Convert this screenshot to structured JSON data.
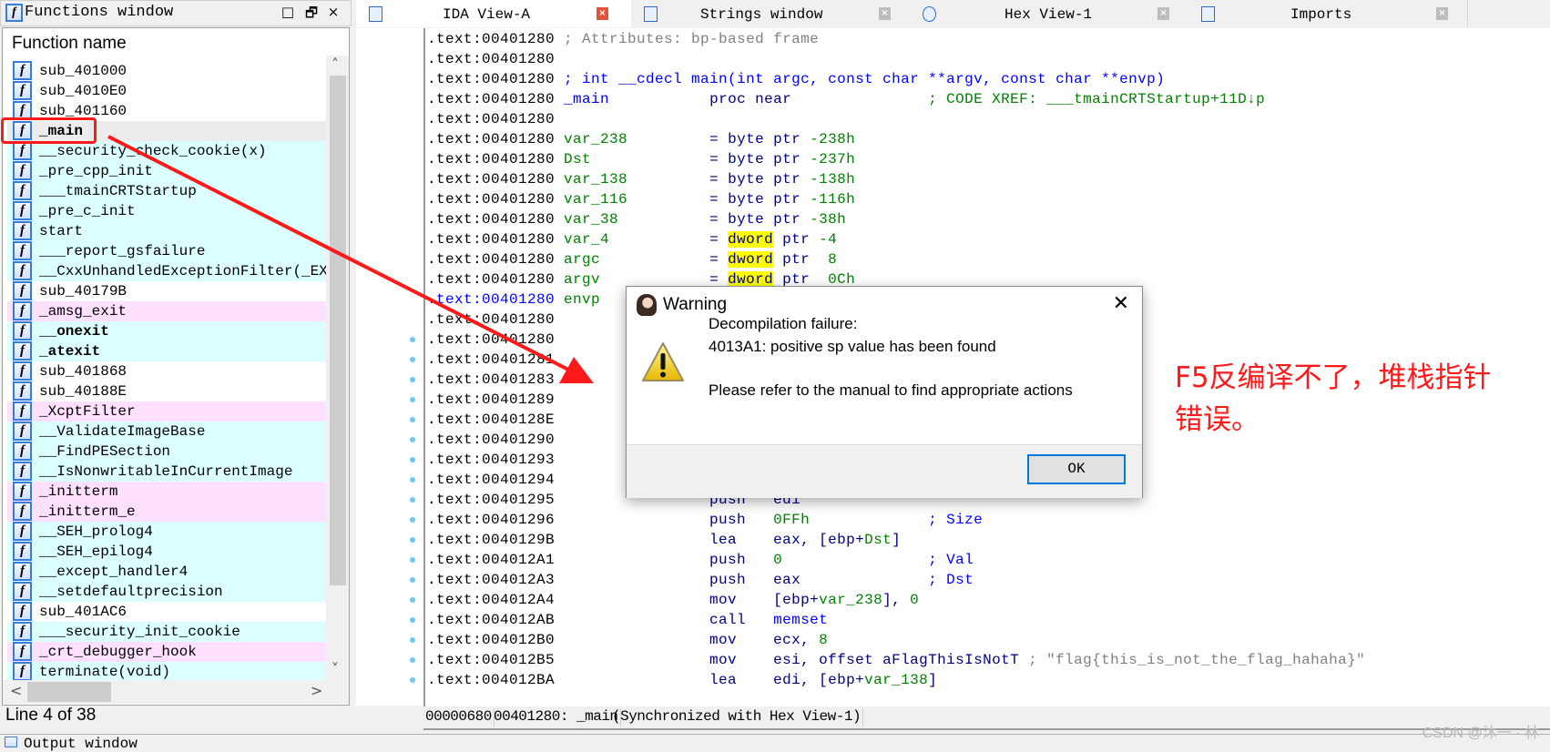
{
  "functions_window": {
    "title": "Functions window",
    "buttons": {
      "maximize": "□",
      "float": "🗗",
      "close": "×"
    },
    "column_header": "Function name",
    "items": [
      {
        "name": "sub_401000",
        "bg": "w"
      },
      {
        "name": "sub_4010E0",
        "bg": "w"
      },
      {
        "name": "sub_401160",
        "bg": "w"
      },
      {
        "name": "_main",
        "bg": "s",
        "bold": true,
        "selected": true
      },
      {
        "name": "__security_check_cookie(x)",
        "bg": "c"
      },
      {
        "name": "_pre_cpp_init",
        "bg": "c"
      },
      {
        "name": "___tmainCRTStartup",
        "bg": "c"
      },
      {
        "name": "_pre_c_init",
        "bg": "c"
      },
      {
        "name": "start",
        "bg": "c"
      },
      {
        "name": "___report_gsfailure",
        "bg": "c"
      },
      {
        "name": "__CxxUnhandledExceptionFilter(_EXCE",
        "bg": "c"
      },
      {
        "name": "sub_40179B",
        "bg": "w"
      },
      {
        "name": "_amsg_exit",
        "bg": "p"
      },
      {
        "name": "__onexit",
        "bg": "c",
        "bold": true
      },
      {
        "name": "_atexit",
        "bg": "c",
        "bold": true
      },
      {
        "name": "sub_401868",
        "bg": "w"
      },
      {
        "name": "sub_40188E",
        "bg": "w"
      },
      {
        "name": "_XcptFilter",
        "bg": "p"
      },
      {
        "name": "__ValidateImageBase",
        "bg": "c"
      },
      {
        "name": "__FindPESection",
        "bg": "c"
      },
      {
        "name": "__IsNonwritableInCurrentImage",
        "bg": "c"
      },
      {
        "name": "_initterm",
        "bg": "p"
      },
      {
        "name": "_initterm_e",
        "bg": "p"
      },
      {
        "name": "__SEH_prolog4",
        "bg": "c"
      },
      {
        "name": "__SEH_epilog4",
        "bg": "c"
      },
      {
        "name": "__except_handler4",
        "bg": "c"
      },
      {
        "name": "__setdefaultprecision",
        "bg": "c"
      },
      {
        "name": "sub_401AC6",
        "bg": "w"
      },
      {
        "name": "___security_init_cookie",
        "bg": "c"
      },
      {
        "name": "_crt_debugger_hook",
        "bg": "p"
      },
      {
        "name": "terminate(void)",
        "bg": "c"
      }
    ],
    "line_info": "Line 4 of 38"
  },
  "tabs": [
    {
      "label": "IDA View-A",
      "active": true,
      "icon": "disassembly-icon"
    },
    {
      "label": "Strings window",
      "active": false,
      "icon": "strings-icon"
    },
    {
      "label": "Hex View-1",
      "active": false,
      "icon": "hex-icon"
    },
    {
      "label": "Imports",
      "active": false,
      "icon": "imports-icon"
    }
  ],
  "disasm": {
    "lines": [
      {
        "addr": ".text:00401280",
        "segs": [
          [
            " ; Attributes: bp-based frame",
            "c"
          ]
        ]
      },
      {
        "addr": ".text:00401280",
        "segs": []
      },
      {
        "addr": ".text:00401280",
        "segs": [
          [
            " ; int __cdecl main(int argc, const char **argv, const char **envp)",
            "b"
          ]
        ]
      },
      {
        "addr": ".text:00401280",
        "segs": [
          [
            " _main",
            "b"
          ],
          [
            "           proc near",
            "n"
          ],
          [
            "               ; CODE XREF: ___tmainCRTStartup+11D↓p",
            "g"
          ]
        ]
      },
      {
        "addr": ".text:00401280",
        "segs": []
      },
      {
        "addr": ".text:00401280",
        "segs": [
          [
            " var_238",
            "g"
          ],
          [
            "         = byte ptr ",
            "n"
          ],
          [
            "-238h",
            "g"
          ]
        ]
      },
      {
        "addr": ".text:00401280",
        "segs": [
          [
            " Dst",
            "g"
          ],
          [
            "             = byte ptr ",
            "n"
          ],
          [
            "-237h",
            "g"
          ]
        ]
      },
      {
        "addr": ".text:00401280",
        "segs": [
          [
            " var_138",
            "g"
          ],
          [
            "         = byte ptr ",
            "n"
          ],
          [
            "-138h",
            "g"
          ]
        ]
      },
      {
        "addr": ".text:00401280",
        "segs": [
          [
            " var_116",
            "g"
          ],
          [
            "         = byte ptr ",
            "n"
          ],
          [
            "-116h",
            "g"
          ]
        ]
      },
      {
        "addr": ".text:00401280",
        "segs": [
          [
            " var_38",
            "g"
          ],
          [
            "          = byte ptr ",
            "n"
          ],
          [
            "-38h",
            "g"
          ]
        ]
      },
      {
        "addr": ".text:00401280",
        "segs": [
          [
            " var_4",
            "g"
          ],
          [
            "           = ",
            "n"
          ],
          [
            "dword",
            "y"
          ],
          [
            " ptr ",
            "n"
          ],
          [
            "-4",
            "g"
          ]
        ]
      },
      {
        "addr": ".text:00401280",
        "segs": [
          [
            " argc",
            "g"
          ],
          [
            "            = ",
            "n"
          ],
          [
            "dword",
            "y"
          ],
          [
            " ptr  ",
            "n"
          ],
          [
            "8",
            "g"
          ]
        ]
      },
      {
        "addr": ".text:00401280",
        "segs": [
          [
            " argv",
            "g"
          ],
          [
            "            = ",
            "n"
          ],
          [
            "dword",
            "y"
          ],
          [
            " ptr  ",
            "n"
          ],
          [
            "0Ch",
            "g"
          ]
        ]
      },
      {
        "addr": ".text:00401280",
        "addr_blue": true,
        "segs": [
          [
            " envp",
            "g"
          ]
        ]
      },
      {
        "addr": ".text:00401280",
        "segs": []
      },
      {
        "addr": ".text:00401280",
        "segs": []
      },
      {
        "addr": ".text:00401281",
        "segs": []
      },
      {
        "addr": ".text:00401283",
        "segs": []
      },
      {
        "addr": ".text:00401289",
        "segs": []
      },
      {
        "addr": ".text:0040128E",
        "segs": []
      },
      {
        "addr": ".text:00401290",
        "segs": []
      },
      {
        "addr": ".text:00401293",
        "segs": []
      },
      {
        "addr": ".text:00401294",
        "segs": []
      },
      {
        "addr": ".text:00401295",
        "segs": [
          [
            "                 push   edi",
            "n"
          ]
        ]
      },
      {
        "addr": ".text:00401296",
        "segs": [
          [
            "                 push   ",
            "n"
          ],
          [
            "0FFh",
            "g"
          ],
          [
            "             ; Size",
            "b"
          ]
        ]
      },
      {
        "addr": ".text:0040129B",
        "segs": [
          [
            "                 lea    eax, [ebp+",
            "n"
          ],
          [
            "Dst",
            "g"
          ],
          [
            "]",
            "n"
          ]
        ]
      },
      {
        "addr": ".text:004012A1",
        "segs": [
          [
            "                 push   ",
            "n"
          ],
          [
            "0",
            "g"
          ],
          [
            "                ; Val",
            "b"
          ]
        ]
      },
      {
        "addr": ".text:004012A3",
        "segs": [
          [
            "                 push   eax",
            "n"
          ],
          [
            "              ; Dst",
            "b"
          ]
        ]
      },
      {
        "addr": ".text:004012A4",
        "segs": [
          [
            "                 mov    [ebp+",
            "n"
          ],
          [
            "var_238",
            "g"
          ],
          [
            "], ",
            "n"
          ],
          [
            "0",
            "g"
          ]
        ]
      },
      {
        "addr": ".text:004012AB",
        "segs": [
          [
            "                 call   ",
            "n"
          ],
          [
            "memset",
            "b"
          ]
        ]
      },
      {
        "addr": ".text:004012B0",
        "segs": [
          [
            "                 mov    ecx, ",
            "n"
          ],
          [
            "8",
            "g"
          ]
        ]
      },
      {
        "addr": ".text:004012B5",
        "segs": [
          [
            "                 mov    esi, offset aFlagThisIsNotT",
            "n"
          ],
          [
            " ; \"flag{this_is_not_the_flag_hahaha}\"",
            "c"
          ]
        ]
      },
      {
        "addr": ".text:004012BA",
        "segs": [
          [
            "                 lea    edi, [ebp+",
            "n"
          ],
          [
            "var_138",
            "g"
          ],
          [
            "]",
            "n"
          ]
        ]
      }
    ],
    "status": [
      "00000680",
      "00401280: _main",
      "(Synchronized with Hex View-1)"
    ]
  },
  "dialog": {
    "title": "Warning",
    "close": "✕",
    "line1": "Decompilation failure:",
    "line2": "4013A1: positive sp value has been found",
    "line3": "Please refer to the manual to find appropriate actions",
    "ok_label": "OK"
  },
  "annotation": {
    "line1": "F5反编译不了，堆栈指针",
    "line2": "错误。",
    "color": "#ff1a1a"
  },
  "output_window": {
    "title": "Output window"
  },
  "watermark": "CSDN @沐一 · 林"
}
